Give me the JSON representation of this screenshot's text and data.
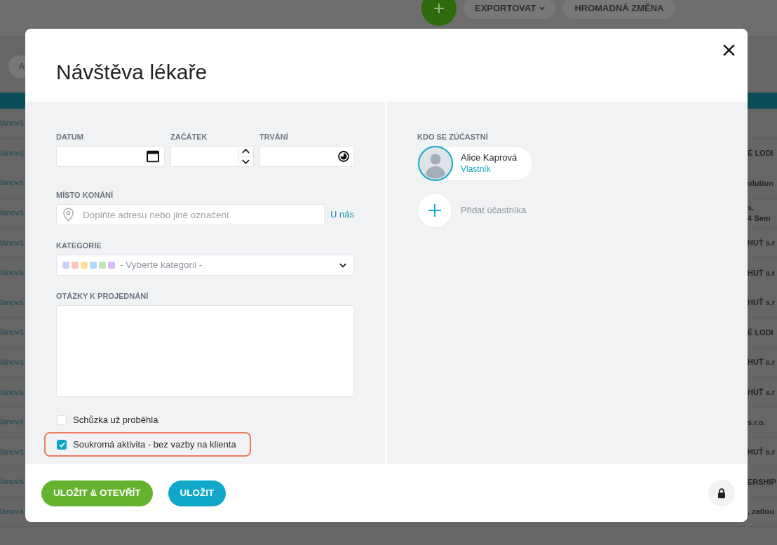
{
  "background": {
    "toolbar": {
      "buttons": [
        {
          "label": "EXPORTOVAT",
          "dropdown": true
        },
        {
          "label": "HROMADNÁ ZMĚNA",
          "dropdown": false
        }
      ]
    },
    "filter_chip": "A",
    "rows": [
      {
        "left": "lánová"
      },
      {
        "left": "lánová",
        "right": [
          "É LODI"
        ]
      },
      {
        "left": "lánová",
        "right": [
          "olution"
        ]
      },
      {
        "left": "lánová",
        "right": [
          "s.",
          "4 Sem"
        ]
      },
      {
        "left": "lánová",
        "right": [
          "HUŤ s.r"
        ]
      },
      {
        "left": "lánová",
        "right": [
          "HUŤ s.r"
        ]
      },
      {
        "left": "lánová",
        "right": [
          "HUŤ s.r"
        ]
      },
      {
        "left": "lánová",
        "right": [
          "É LODI"
        ]
      },
      {
        "left": "lánová",
        "right": [
          "HUŤ s.r"
        ]
      },
      {
        "left": "lánová",
        "right": [
          "HUŤ s.r"
        ]
      },
      {
        "left": "lánová",
        "right": [
          "s.r.o."
        ]
      },
      {
        "left": "lánová",
        "right": [
          "HUŤ s.r"
        ]
      },
      {
        "left": "lánová",
        "right": [
          "ERSHIP"
        ]
      },
      {
        "left": "lánová",
        "right": [
          ", zatlou"
        ]
      }
    ]
  },
  "dialog": {
    "title": "Návštěva lékaře",
    "time_fields": [
      {
        "kind": "date",
        "label": "DATUM"
      },
      {
        "kind": "time",
        "label": "ZAČÁTEK"
      },
      {
        "kind": "duration",
        "label": "TRVÁNÍ"
      }
    ],
    "location": {
      "label": "MÍSTO KONÁNÍ",
      "placeholder": "Doplňte adresu nebo jiné označení",
      "link": "U nás"
    },
    "category": {
      "label": "KATEGORIE",
      "placeholder": "- Vyberte kategorii -",
      "swatches": [
        {
          "color": "#cdd0fb"
        },
        {
          "color": "#fdc3b5"
        },
        {
          "color": "#fddd9c"
        },
        {
          "color": "#b3d6fb"
        },
        {
          "color": "#bfe8b0"
        },
        {
          "color": "#d7baf8"
        }
      ]
    },
    "questions": {
      "label": "OTÁZKY K PROJEDNÁNÍ"
    },
    "checkboxes": [
      {
        "label": "Schůzka už proběhla",
        "checked": false,
        "highlighted": false
      },
      {
        "label": "Soukromá aktivita - bez vazby na klienta",
        "checked": true,
        "highlighted": true
      }
    ],
    "participants": {
      "label": "KDO SE ZÚČASTNÍ",
      "people": [
        {
          "name": "Alice Kaprová",
          "role": "Vlastník"
        }
      ],
      "add_label": "Přidat účastníka"
    },
    "buttons": [
      {
        "label": "ULOŽIT & OTEVŘÍT",
        "kind": "primary"
      },
      {
        "label": "ULOŽIT",
        "kind": "secondary"
      }
    ]
  }
}
